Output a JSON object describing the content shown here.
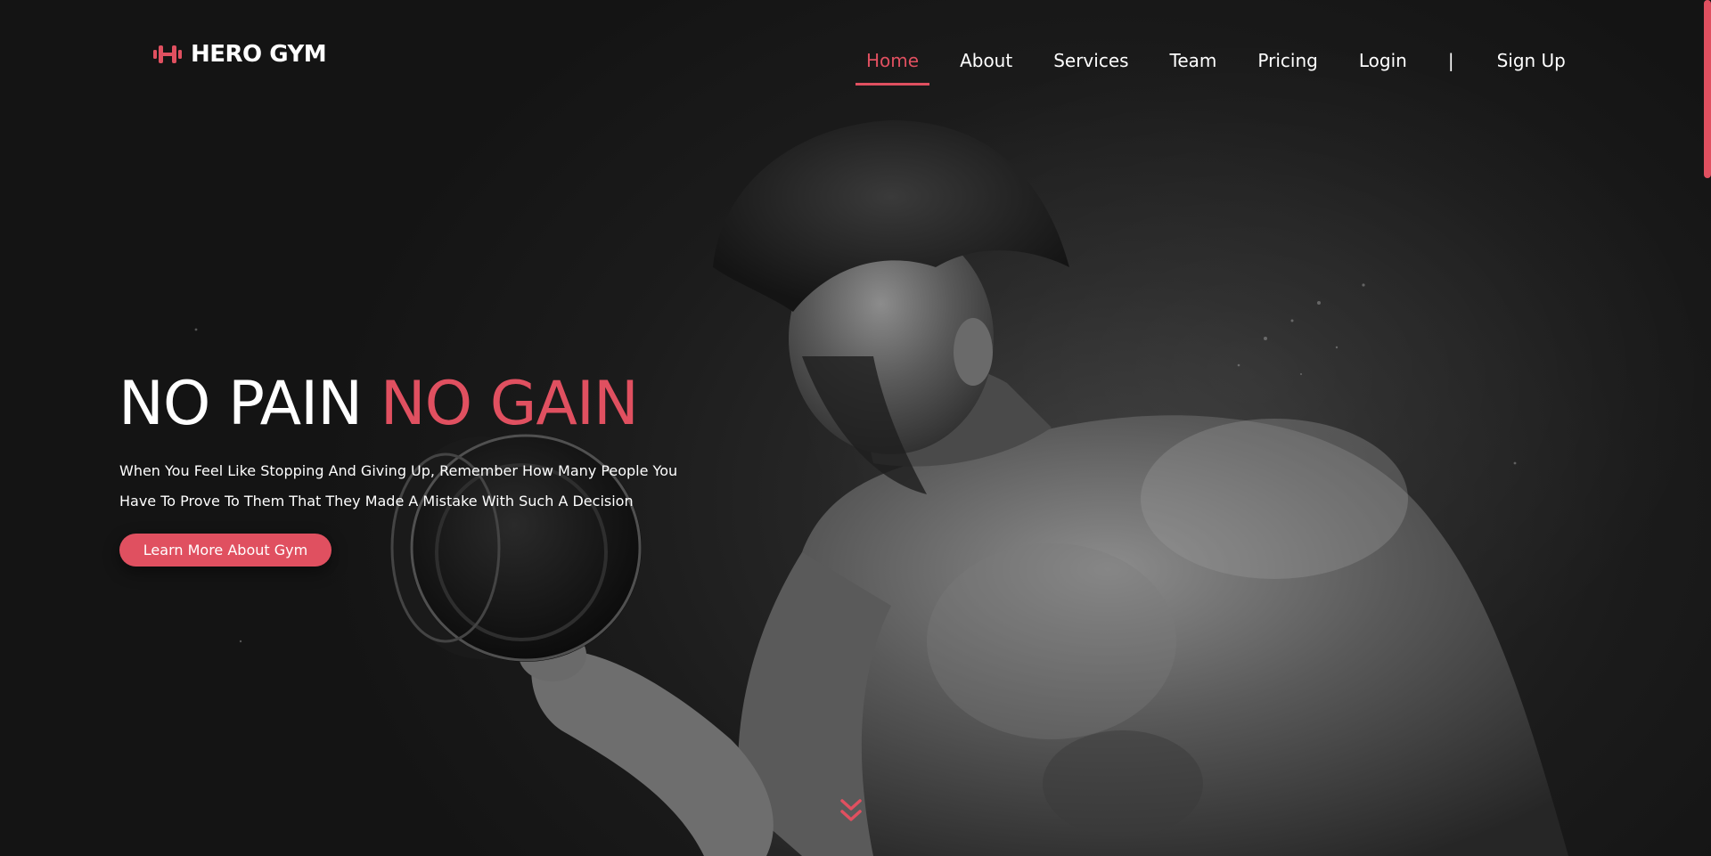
{
  "brand": {
    "name": "HERO GYM",
    "icon": "dumbbell-icon",
    "accent_color": "#e05060"
  },
  "nav": {
    "items": [
      {
        "label": "Home",
        "active": true
      },
      {
        "label": "About",
        "active": false
      },
      {
        "label": "Services",
        "active": false
      },
      {
        "label": "Team",
        "active": false
      },
      {
        "label": "Pricing",
        "active": false
      },
      {
        "label": "Login",
        "active": false
      }
    ],
    "separator": "|",
    "signup_label": "Sign Up"
  },
  "hero": {
    "title_part1": "NO PAIN ",
    "title_part2": "NO GAIN",
    "subtitle_line1": "When You Feel Like Stopping And Giving Up, Remember How Many People You",
    "subtitle_line2": "Have To Prove To Them That They Made A Mistake With Such A Decision",
    "cta_label": "Learn More About Gym",
    "background_image": "bodybuilder-curling-dumbbell-photo",
    "scroll_icon": "double-chevron-down-icon"
  }
}
